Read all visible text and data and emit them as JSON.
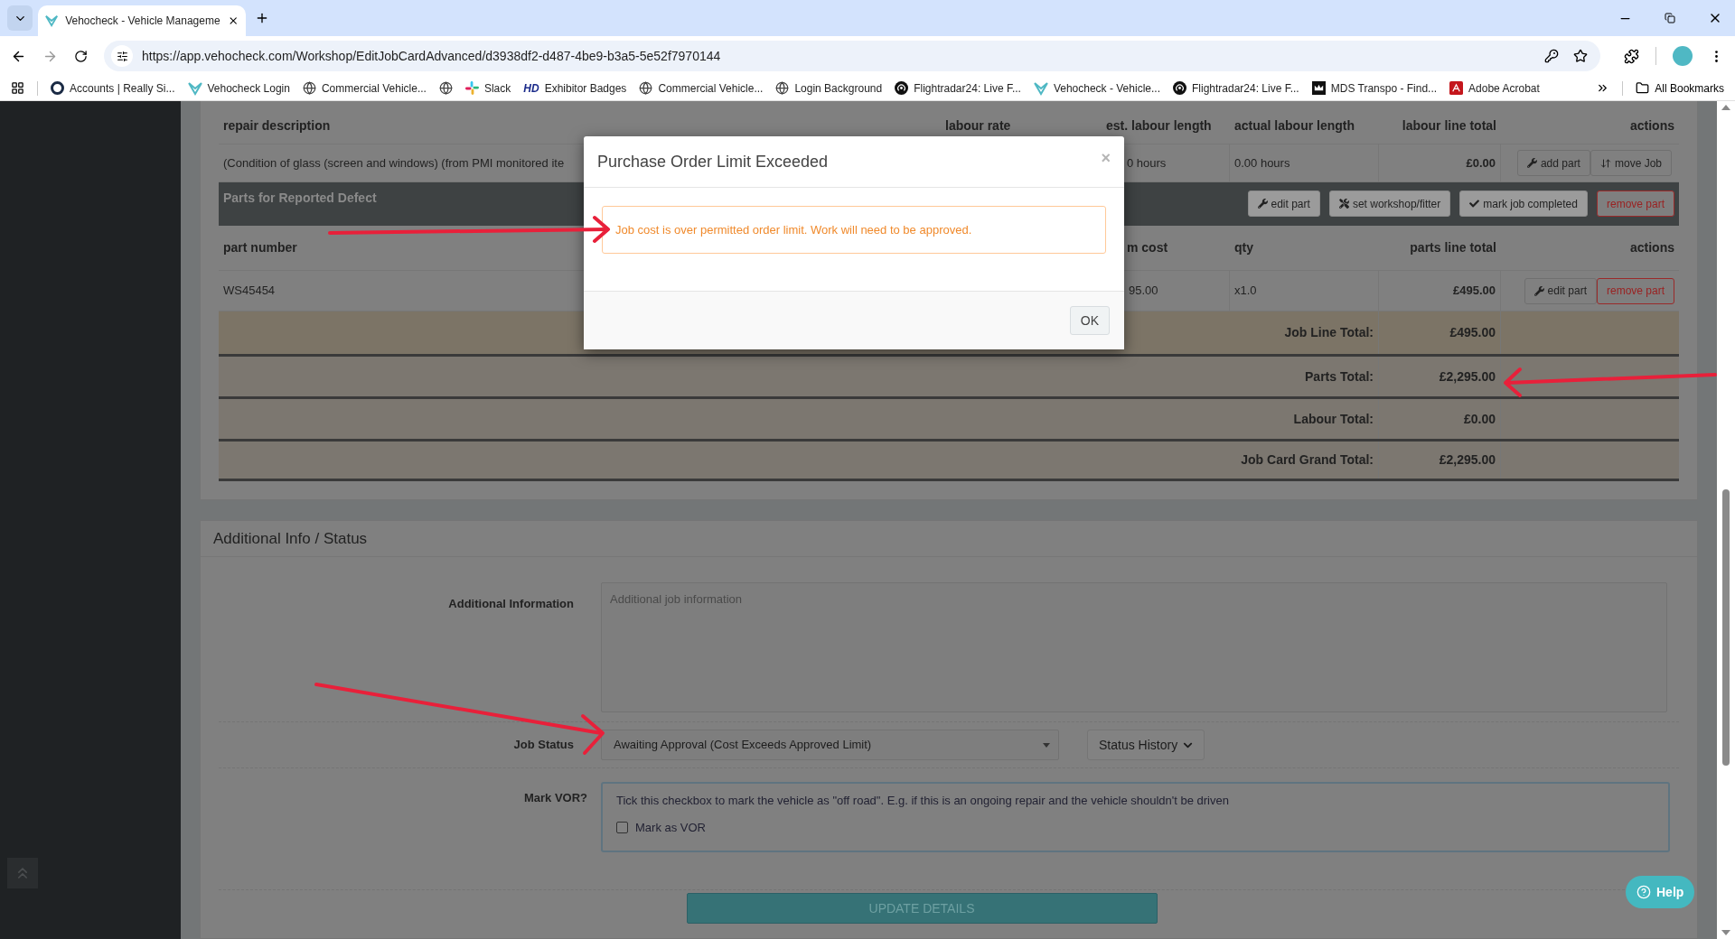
{
  "browser": {
    "tab_title": "Vehocheck - Vehicle Manageme",
    "url": "https://app.vehocheck.com/Workshop/EditJobCardAdvanced/d3938df2-d487-4be9-b3a5-5e52f7970144",
    "bookmarks": [
      {
        "label": "Accounts | Really Si..."
      },
      {
        "label": "Vehocheck Login"
      },
      {
        "label": "Commercial Vehicle..."
      },
      {
        "label": "Slack"
      },
      {
        "label": "Exhibitor Badges",
        "icon_text": "HD"
      },
      {
        "label": "Commercial Vehicle..."
      },
      {
        "label": "Login Background"
      },
      {
        "label": "Flightradar24: Live F..."
      },
      {
        "label": "Vehocheck - Vehicle..."
      },
      {
        "label": "Flightradar24: Live F..."
      },
      {
        "label": "MDS Transpo - Find..."
      },
      {
        "label": "Adobe Acrobat"
      }
    ],
    "all_bookmarks": "All Bookmarks"
  },
  "labour_table": {
    "columns": [
      "repair description",
      "labour rate",
      "est. labour length",
      "actual labour length",
      "labour line total",
      "actions"
    ],
    "row": {
      "description": "(Condition of glass (screen and windows) (from PMI monitored ite",
      "est": "0 hours",
      "actual": "0.00 hours",
      "total": "£0.00",
      "actions": [
        {
          "label": "add part"
        },
        {
          "label": "move Job"
        }
      ]
    }
  },
  "parts_band": {
    "title": "Parts for Reported Defect",
    "buttons": [
      {
        "label": "edit part",
        "kind": "default"
      },
      {
        "label": "set workshop/fitter",
        "kind": "default"
      },
      {
        "label": "mark job completed",
        "kind": "default"
      },
      {
        "label": "remove part",
        "kind": "danger"
      }
    ]
  },
  "parts_table": {
    "columns": {
      "part_number": "part number",
      "cost": "m cost",
      "qty": "qty",
      "total": "parts line total",
      "actions": "actions"
    },
    "row": {
      "part_number": "WS45454",
      "cost": "95.00",
      "qty": "x1.0",
      "total": "£495.00",
      "actions": [
        {
          "label": "edit part",
          "kind": "default"
        },
        {
          "label": "remove part",
          "kind": "danger"
        }
      ]
    }
  },
  "totals": [
    {
      "label": "Job Line Total:",
      "value": "£495.00",
      "kind": "line"
    },
    {
      "label": "Parts Total:",
      "value": "£2,295.00",
      "kind": "summary"
    },
    {
      "label": "Labour Total:",
      "value": "£0.00",
      "kind": "summary"
    },
    {
      "label": "Job Card Grand Total:",
      "value": "£2,295.00",
      "kind": "summary"
    }
  ],
  "additional": {
    "title": "Additional Info / Status",
    "info_label": "Additional Information",
    "info_placeholder": "Additional job information",
    "status_label": "Job Status",
    "status_value": "Awaiting Approval (Cost Exceeds Approved Limit)",
    "status_history": "Status History",
    "vor_label": "Mark VOR?",
    "vor_hint": "Tick this checkbox to mark the vehicle as \"off road\". E.g. if this is an ongoing repair and the vehicle shouldn't be driven",
    "vor": {
      "label": "Mark as VOR",
      "checked": false
    },
    "update": "UPDATE DETAILS"
  },
  "help": "Help",
  "modal": {
    "title": "Purchase Order Limit Exceeded",
    "close": "×",
    "message": "Job cost is over permitted order limit. Work will need to be approved.",
    "ok": "OK"
  }
}
